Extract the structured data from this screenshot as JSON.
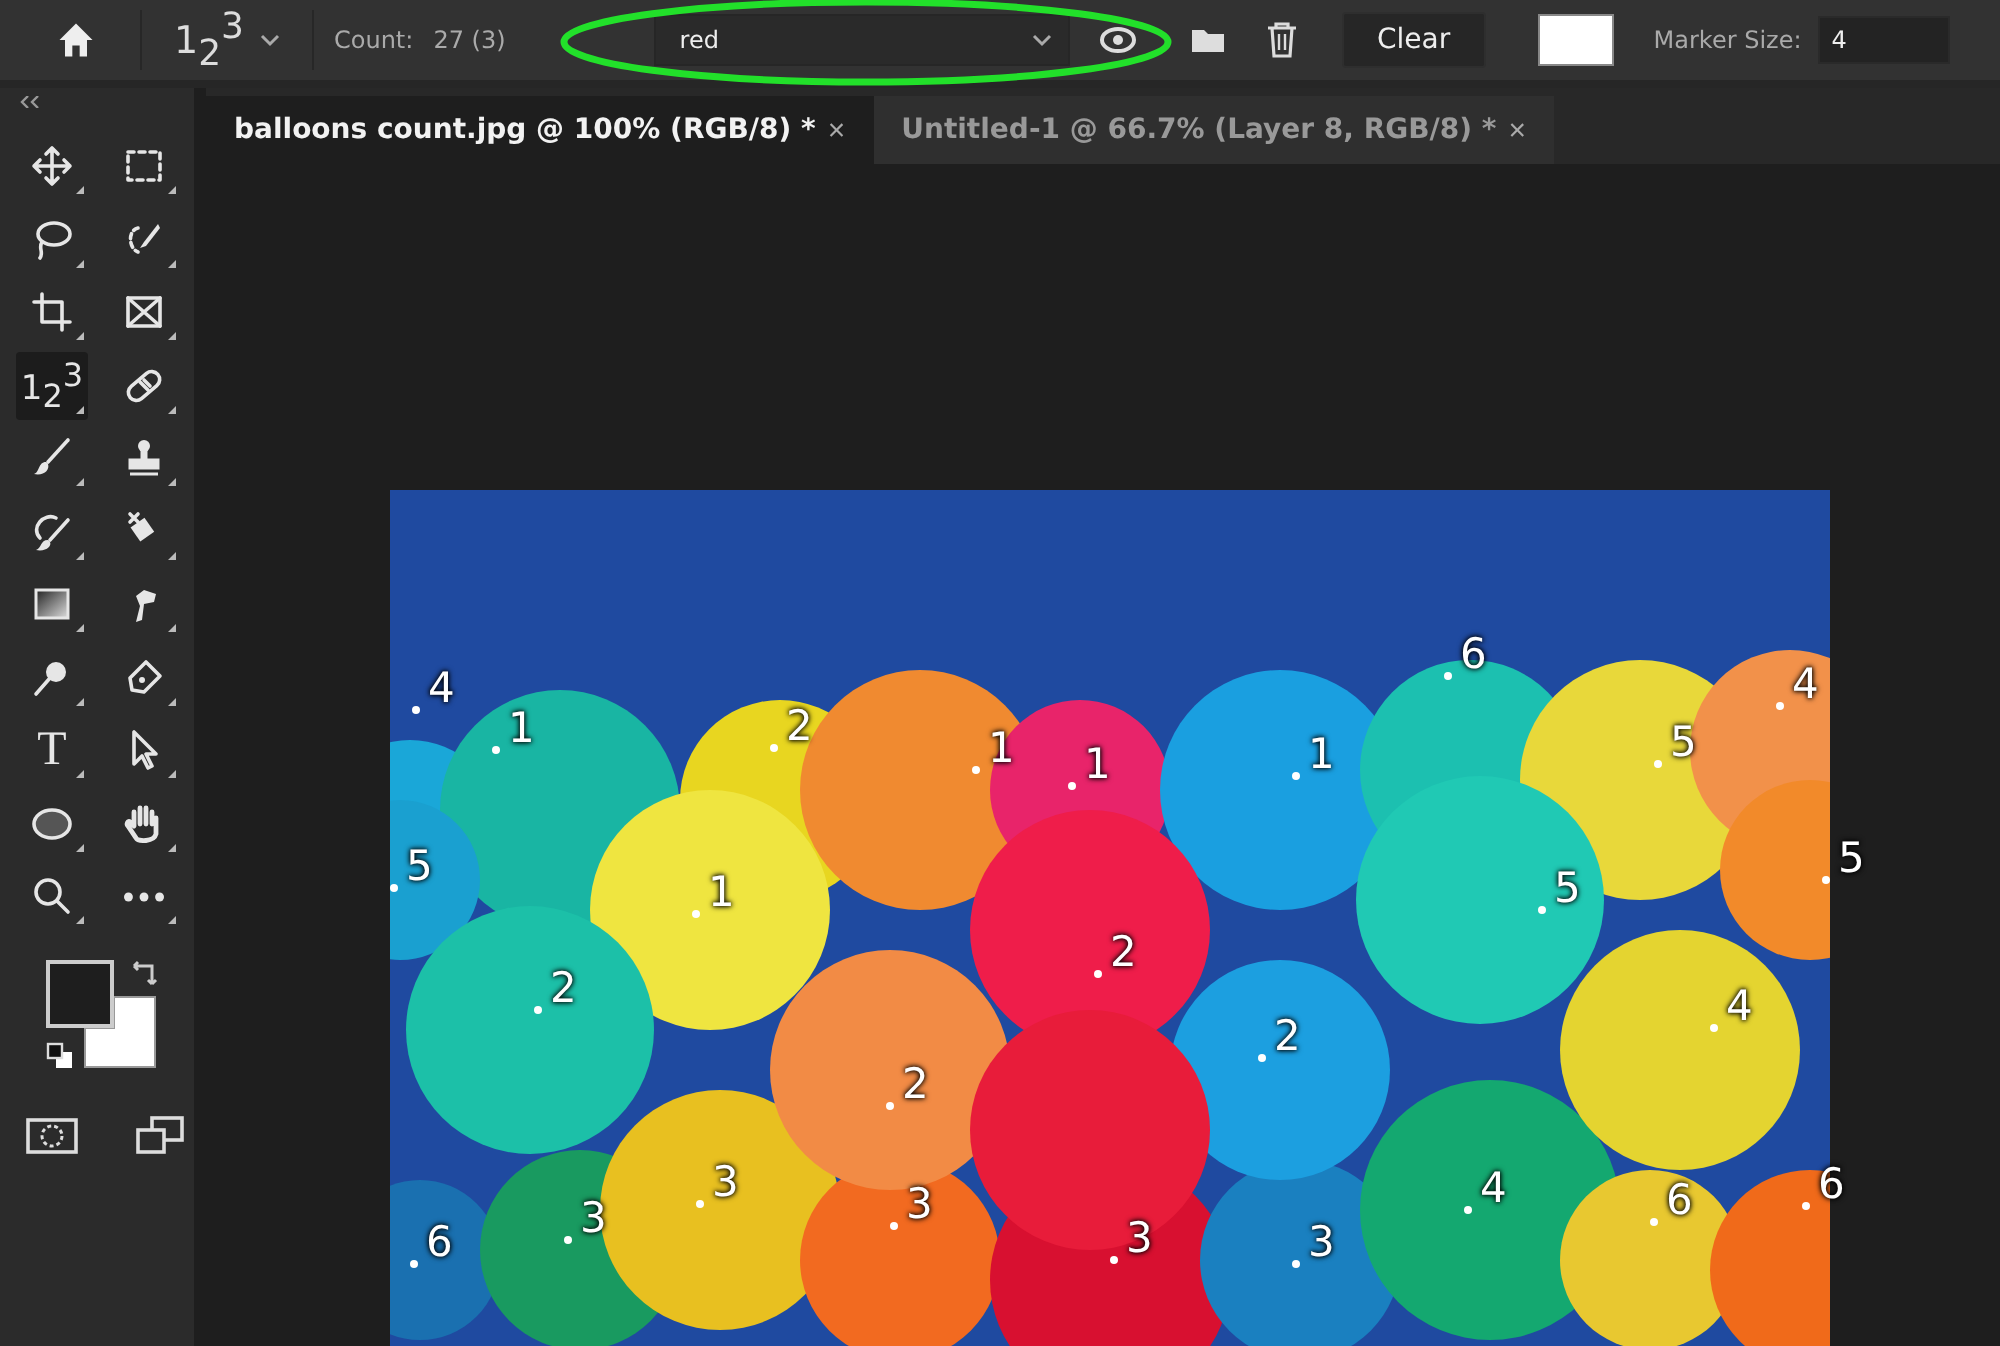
{
  "options_bar": {
    "tool_preset": "1$_{2}$$^{3}$",
    "count_label": "Count:",
    "count_value": "27 (3)",
    "count_group": {
      "value": "red"
    },
    "clear_button": "Clear",
    "marker_size_label": "Marker Size:",
    "marker_size": "4"
  },
  "tabs": [
    {
      "label": "balloons count.jpg @ 100% (RGB/8) *",
      "close": "×",
      "selected": true
    },
    {
      "label": "Untitled-1 @ 66.7% (Layer 8, RGB/8) *",
      "close": "×",
      "selected": false
    }
  ],
  "tools": [
    {
      "kind": "move",
      "selected": false
    },
    {
      "kind": "marquee",
      "selected": false
    },
    {
      "kind": "lasso",
      "selected": false
    },
    {
      "kind": "quick-select",
      "selected": false
    },
    {
      "kind": "crop",
      "selected": false
    },
    {
      "kind": "frame",
      "selected": false
    },
    {
      "kind": "count",
      "glyph": "1$_{2}$$^{3}$",
      "selected": true
    },
    {
      "kind": "healing",
      "selected": false
    },
    {
      "kind": "brush",
      "selected": false
    },
    {
      "kind": "stamp",
      "selected": false
    },
    {
      "kind": "history-brush",
      "selected": false
    },
    {
      "kind": "eraser",
      "selected": false
    },
    {
      "kind": "gradient",
      "selected": false
    },
    {
      "kind": "smudge",
      "selected": false
    },
    {
      "kind": "dodge",
      "selected": false
    },
    {
      "kind": "pen",
      "selected": false
    },
    {
      "kind": "type",
      "glyph": "T",
      "selected": false
    },
    {
      "kind": "path-select",
      "selected": false
    },
    {
      "kind": "ellipse",
      "selected": false
    },
    {
      "kind": "hand",
      "selected": false
    },
    {
      "kind": "zoom",
      "selected": false
    },
    {
      "kind": "more",
      "selected": false
    }
  ],
  "canvas": {
    "markers": [
      {
        "label": "4"
      },
      {
        "label": "1"
      },
      {
        "label": "5"
      },
      {
        "label": "2"
      },
      {
        "label": "1"
      },
      {
        "label": "1"
      },
      {
        "label": "1"
      },
      {
        "label": "6"
      },
      {
        "label": "5"
      },
      {
        "label": "4"
      },
      {
        "label": "1"
      },
      {
        "label": "2"
      },
      {
        "label": "5"
      },
      {
        "label": "5"
      },
      {
        "label": "2"
      },
      {
        "label": "2"
      },
      {
        "label": "4"
      },
      {
        "label": "2"
      },
      {
        "label": "3"
      },
      {
        "label": "6"
      },
      {
        "label": "3"
      },
      {
        "label": "3"
      },
      {
        "label": "3"
      },
      {
        "label": "3"
      },
      {
        "label": "4"
      },
      {
        "label": "6"
      },
      {
        "label": "6"
      }
    ]
  }
}
